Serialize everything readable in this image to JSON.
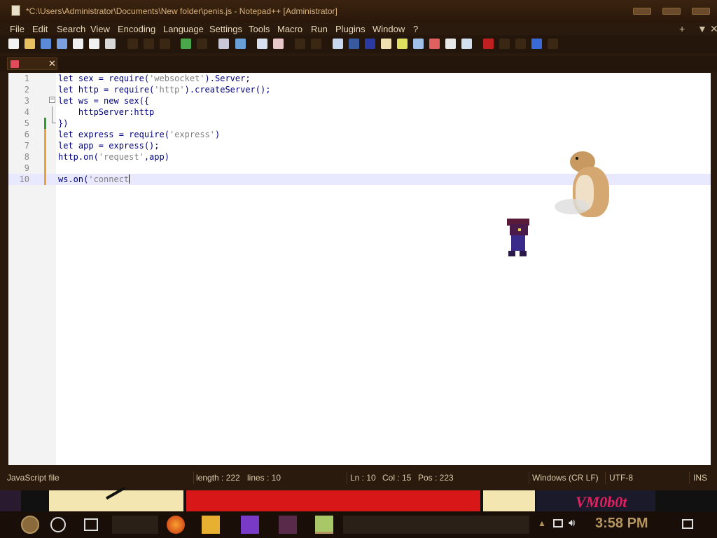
{
  "window": {
    "title": "*C:\\Users\\Administrator\\Documents\\New folder\\penis.js - Notepad++ [Administrator]"
  },
  "menu": {
    "items": [
      "File",
      "Edit",
      "Search",
      "View",
      "Encoding",
      "Language",
      "Settings",
      "Tools",
      "Macro",
      "Run",
      "Plugins",
      "Window",
      "?"
    ],
    "right": [
      "+",
      "▼",
      "✕"
    ]
  },
  "tabs": [
    {
      "label": "",
      "modified": true
    }
  ],
  "editor": {
    "lines": [
      {
        "number": "1",
        "text": "let sex = require('websocket').Server;"
      },
      {
        "number": "2",
        "text": "let http = require('http').createServer();"
      },
      {
        "number": "3",
        "text": "let ws = new sex({"
      },
      {
        "number": "4",
        "text": "    httpServer:http"
      },
      {
        "number": "5",
        "text": "})"
      },
      {
        "number": "6",
        "text": "let express = require('express')"
      },
      {
        "number": "7",
        "text": "let app = express();"
      },
      {
        "number": "8",
        "text": "http.on('request',app)"
      },
      {
        "number": "9",
        "text": ""
      },
      {
        "number": "10",
        "text": "ws.on('connect"
      }
    ],
    "current_line": 10
  },
  "status": {
    "file_type": "JavaScript file",
    "length": "length : 222",
    "lines": "lines : 10",
    "ln": "Ln : 10",
    "col": "Col : 15",
    "pos": "Pos : 223",
    "eol": "Windows (CR LF)",
    "encoding": "UTF-8",
    "mode": "INS"
  },
  "desktop": {
    "banner_text": "VM0b0t"
  },
  "taskbar": {
    "clock": "3:58 PM"
  },
  "colors": {
    "keyword": "#000080",
    "string": "#808080",
    "current_line": "#e8e8ff",
    "title_text": "#d9b27a"
  }
}
